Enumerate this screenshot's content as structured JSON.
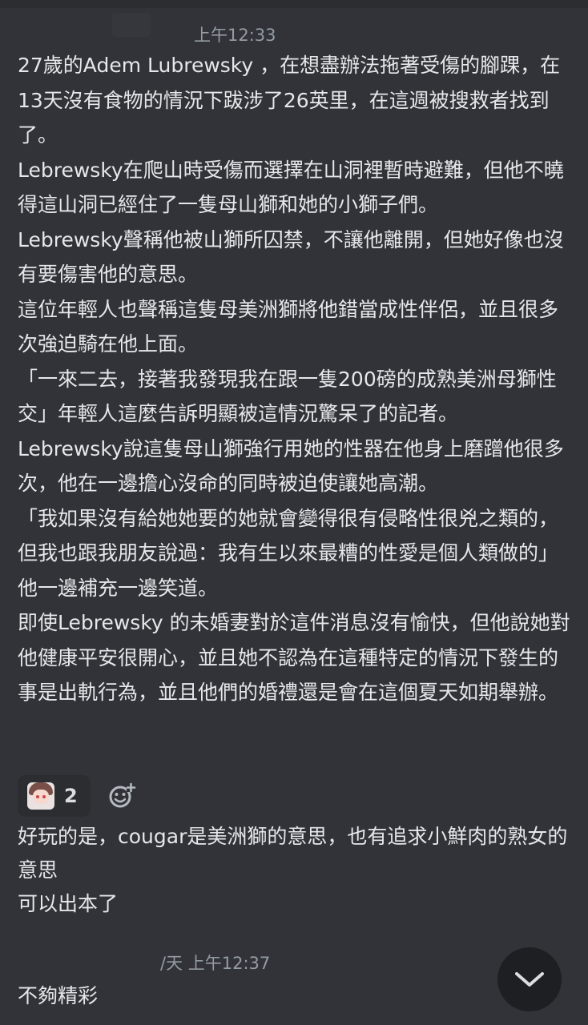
{
  "messages": [
    {
      "timestamp": "上午12:33",
      "paragraphs": [
        "27歲的Adem Lubrewsky ，在想盡辦法拖著受傷的腳踝，在13天沒有食物的情況下跋涉了26英里，在這週被搜救者找到了。",
        "Lebrewsky在爬山時受傷而選擇在山洞裡暫時避難，但他不曉得這山洞已經住了一隻母山獅和她的小獅子們。",
        "Lebrewsky聲稱他被山獅所囚禁，不讓他離開，但她好像也沒有要傷害他的意思。",
        "這位年輕人也聲稱這隻母美洲獅將他錯當成性伴侶，並且很多次強迫騎在他上面。",
        "「一來二去，接著我發現我在跟一隻200磅的成熟美洲母獅性交」年輕人這麼告訴明顯被這情況驚呆了的記者。",
        "Lebrewsky說這隻母山獅強行用她的性器在他身上磨蹭他很多次，他在一邊擔心沒命的同時被迫使讓她高潮。",
        "「我如果沒有給她她要的她就會變得很有侵略性很兇之類的，但我也跟我朋友說過：我有生以來最糟的性愛是個人類做的」他一邊補充一邊笑道。",
        "即使Lebrewsky 的未婚妻對於這件消息沒有愉快，但他說她對他健康平安很開心，並且她不認為在這種特定的情況下發生的事是出軌行為，並且他們的婚禮還是會在這個夏天如期舉辦。"
      ],
      "reaction": {
        "emoji": "anime-avatar-emoji",
        "count": "2"
      },
      "add_reaction_icon": "add-reaction-icon"
    },
    {
      "paragraphs": [
        "好玩的是，cougar是美洲獅的意思，也有追求小鮮肉的熟女的意思",
        "可以出本了"
      ]
    },
    {
      "timestamp": "/天 上午12:37",
      "paragraphs": [
        "不夠精彩"
      ]
    }
  ],
  "scroll_button_icon": "chevron-down-icon",
  "colors": {
    "background": "#313338",
    "text": "#dbdee1",
    "timestamp": "#949ba4",
    "reaction_bg": "#2b2d31",
    "scroll_button_bg": "#1e1f22"
  }
}
